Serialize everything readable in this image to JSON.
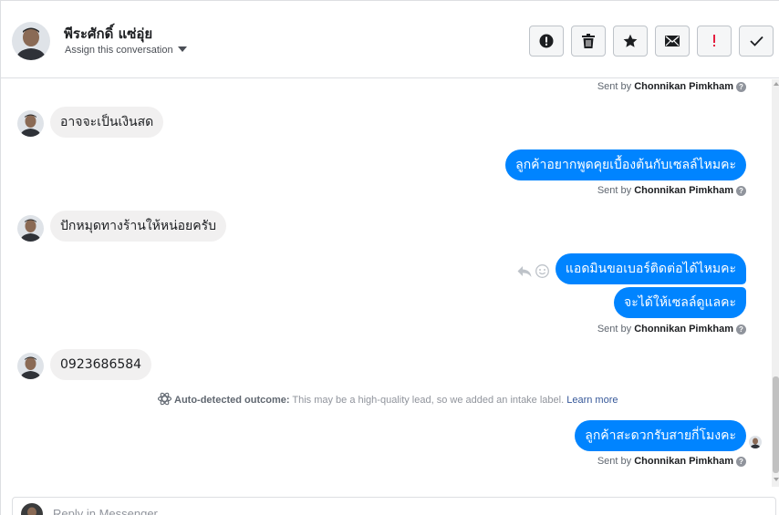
{
  "header": {
    "name": "พีระศักดิ์ แซ่อุ่ย",
    "assign_label": "Assign this conversation",
    "actions": [
      {
        "icon": "spam-alert-icon",
        "label": "Mark as spam"
      },
      {
        "icon": "trash-icon",
        "label": "Delete"
      },
      {
        "icon": "star-icon",
        "label": "Star"
      },
      {
        "icon": "envelope-icon",
        "label": "Mark as unread"
      },
      {
        "icon": "exclamation-icon",
        "label": "Mark as important"
      },
      {
        "icon": "checkmark-icon",
        "label": "Mark as done"
      }
    ]
  },
  "conversation": {
    "sent_by_prefix": "Sent by",
    "sender": "Chonnikan Pimkham",
    "messages": [
      {
        "direction": "in",
        "text": "อาจจะเป็นเงินสด"
      },
      {
        "direction": "out",
        "text": "ลูกค้าอยากพูดคุยเบื้องต้นกับเซลล์ไหมคะ"
      },
      {
        "direction": "in",
        "text": "ปักหมุดทางร้านให้หน่อยครับ"
      },
      {
        "direction": "out",
        "text": "แอดมินขอเบอร์ติดต่อได้ไหมคะ"
      },
      {
        "direction": "out",
        "text": "จะได้ให้เซลล์ดูแลคะ"
      },
      {
        "direction": "in",
        "text": "0923686584"
      },
      {
        "direction": "out",
        "text": "ลูกค้าสะดวกรับสายกี่โมงคะ"
      }
    ],
    "outcome": {
      "title": "Auto-detected outcome:",
      "text": "This may be a high-quality lead, so we added an intake label.",
      "link": "Learn more"
    }
  },
  "reply": {
    "placeholder": "Reply in Messenger..."
  },
  "colors": {
    "accent": "#0084ff",
    "incoming_bubble": "#f1f0f0",
    "link": "#365899",
    "important_red": "#e41e3f"
  }
}
